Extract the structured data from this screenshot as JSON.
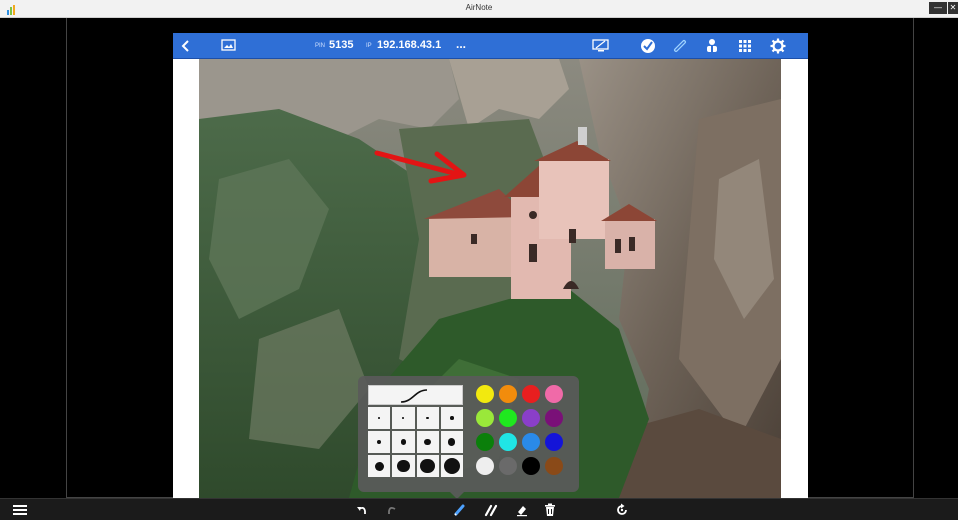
{
  "window": {
    "title": "AirNote",
    "minimize_label": "—",
    "close_label": "✕"
  },
  "topbar": {
    "pin_label": "PIN",
    "pin": "5135",
    "ip_label": "IP",
    "ip": "192.168.43.1",
    "more": "...",
    "icons": [
      "back-arrow-icon",
      "gallery-icon",
      "screen-share-icon",
      "check-icon",
      "link-icon",
      "participants-icon",
      "grid-icon",
      "gear-icon"
    ],
    "accent": "#2f6fd6"
  },
  "pen_picker": {
    "stroke_sizes": [
      1,
      1,
      1.5,
      2,
      2.5,
      3,
      3.5,
      4,
      5,
      7,
      8,
      9
    ],
    "colors": [
      "#f2e90f",
      "#f28c0c",
      "#e81f1f",
      "#f06aa8",
      "#9ae83a",
      "#1fe81f",
      "#8a3fc9",
      "#7a1078",
      "#0b7f0b",
      "#20e5e5",
      "#2a8ae8",
      "#1414d8",
      "#eeeeee",
      "#6a6a6a",
      "#000000",
      "#8a4a18"
    ]
  },
  "bottom_toolbar": {
    "icons": [
      "menu-icon",
      "undo-icon",
      "redo-icon",
      "pen-icon",
      "highlighter-icon",
      "eraser-icon",
      "trash-icon",
      "rotate-icon"
    ]
  }
}
